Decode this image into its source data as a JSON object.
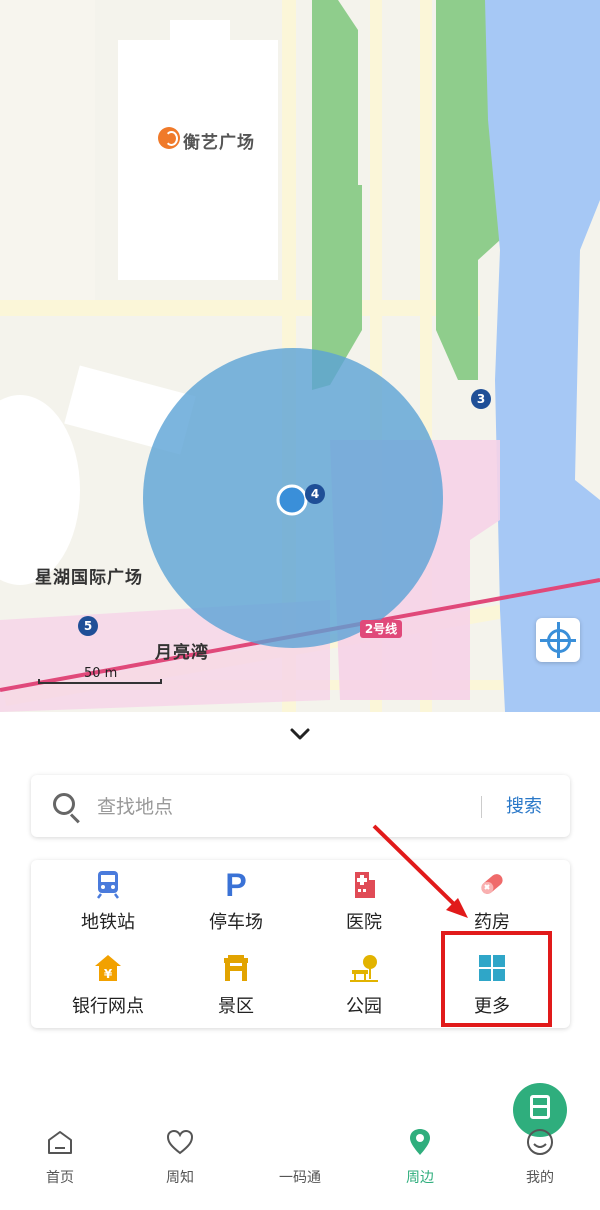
{
  "map": {
    "places": {
      "plaza": "衡艺广场",
      "xinghu": "星湖国际广场",
      "yueliangwan": "月亮湾"
    },
    "stations": [
      "3",
      "4",
      "5"
    ],
    "metro_line_badge": "2号线",
    "scale": "50 m"
  },
  "panel": {
    "collapse_icon": "chevron-down-icon",
    "search": {
      "placeholder": "查找地点",
      "button": "搜索"
    },
    "categories": [
      {
        "label": "地铁站",
        "icon": "subway-icon",
        "color": "#4a7bdc"
      },
      {
        "label": "停车场",
        "icon": "parking-icon",
        "color": "#3a72d6"
      },
      {
        "label": "医院",
        "icon": "hospital-icon",
        "color": "#e04b56"
      },
      {
        "label": "药房",
        "icon": "pill-icon",
        "color": "#ef6a6a"
      },
      {
        "label": "银行网点",
        "icon": "bank-icon",
        "color": "#f2a100"
      },
      {
        "label": "景区",
        "icon": "scenic-gate-icon",
        "color": "#e2a300"
      },
      {
        "label": "公园",
        "icon": "park-icon",
        "color": "#e2b300"
      },
      {
        "label": "更多",
        "icon": "grid-more-icon",
        "color": "#2fa6c8"
      }
    ]
  },
  "nav": {
    "tabs": [
      {
        "label": "首页",
        "icon": "home-icon"
      },
      {
        "label": "周知",
        "icon": "heart-icon"
      },
      {
        "label": "一码通",
        "icon": "qr-code-icon"
      },
      {
        "label": "周边",
        "icon": "location-pin-icon"
      },
      {
        "label": "我的",
        "icon": "smiley-icon"
      }
    ],
    "active_tab": "周边",
    "accent": "#2fae7d"
  },
  "annotation": {
    "highlight_color": "#e11a1a"
  }
}
